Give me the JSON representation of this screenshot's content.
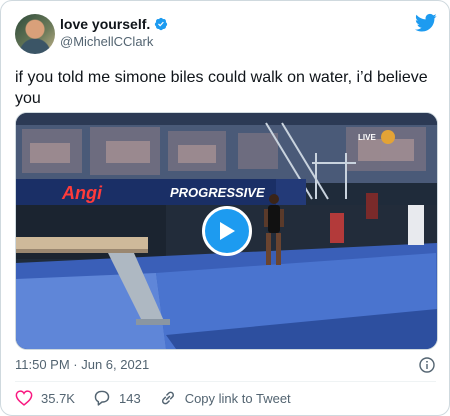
{
  "author": {
    "display_name": "love yourself.",
    "handle": "@MichellCClark",
    "verified_icon": "verified-badge-icon"
  },
  "brand_icon": "twitter-bird-icon",
  "tweet": {
    "text": "if you told me simone biles could walk on water, i’d believe you"
  },
  "media": {
    "type": "video",
    "play_icon": "play-icon",
    "banner_left": "Angi",
    "banner_right": "PROGRESSIVE",
    "live_label": "LIVE"
  },
  "meta": {
    "timestamp": "11:50 PM · Jun 6, 2021",
    "info_icon": "info-icon"
  },
  "actions": {
    "like_count": "35.7K",
    "reply_count": "143",
    "copy_link_label": "Copy link to Tweet"
  },
  "colors": {
    "accent": "#1d9bf0",
    "like": "#f91880",
    "text": "#0f1419",
    "secondary": "#536471"
  }
}
